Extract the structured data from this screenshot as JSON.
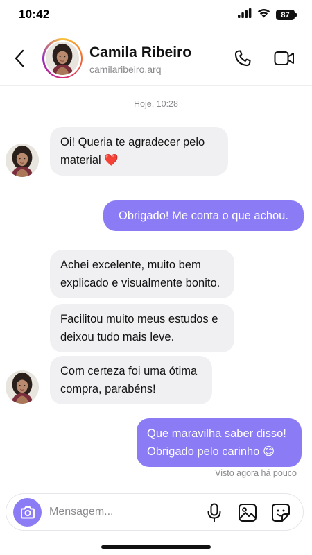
{
  "status_bar": {
    "time": "10:42",
    "battery": "87",
    "icons": [
      "signal-icon",
      "wifi-icon",
      "battery-icon"
    ]
  },
  "header": {
    "name": "Camila Ribeiro",
    "handle": "camilaribeiro.arq",
    "icons": [
      "back-arrow-icon",
      "phone-icon",
      "video-camera-icon"
    ]
  },
  "chat": {
    "date_stamp": "Hoje, 10:28",
    "messages": [
      {
        "direction": "in",
        "text": "Oi! Queria te agradecer pelo material ❤️"
      },
      {
        "direction": "out",
        "text": "Obrigado! Me conta o que achou."
      },
      {
        "direction": "in",
        "text": "Achei excelente, muito bem explicado e visualmente bonito."
      },
      {
        "direction": "in",
        "text": "Facilitou muito meus estudos e deixou tudo mais leve."
      },
      {
        "direction": "in",
        "text": "Com certeza foi uma ótima compra, parabéns!"
      },
      {
        "direction": "out",
        "text": "Que maravilha saber disso! Obrigado pelo carinho 😊"
      }
    ],
    "seen_status": "Visto agora há pouco"
  },
  "composer": {
    "placeholder": "Mensagem...",
    "icons": [
      "camera-icon",
      "microphone-icon",
      "image-icon",
      "sticker-icon"
    ]
  },
  "colors": {
    "accent": "#8b7cf6",
    "incoming_bubble": "#f0f0f2",
    "muted_text": "#8a8a8e"
  }
}
